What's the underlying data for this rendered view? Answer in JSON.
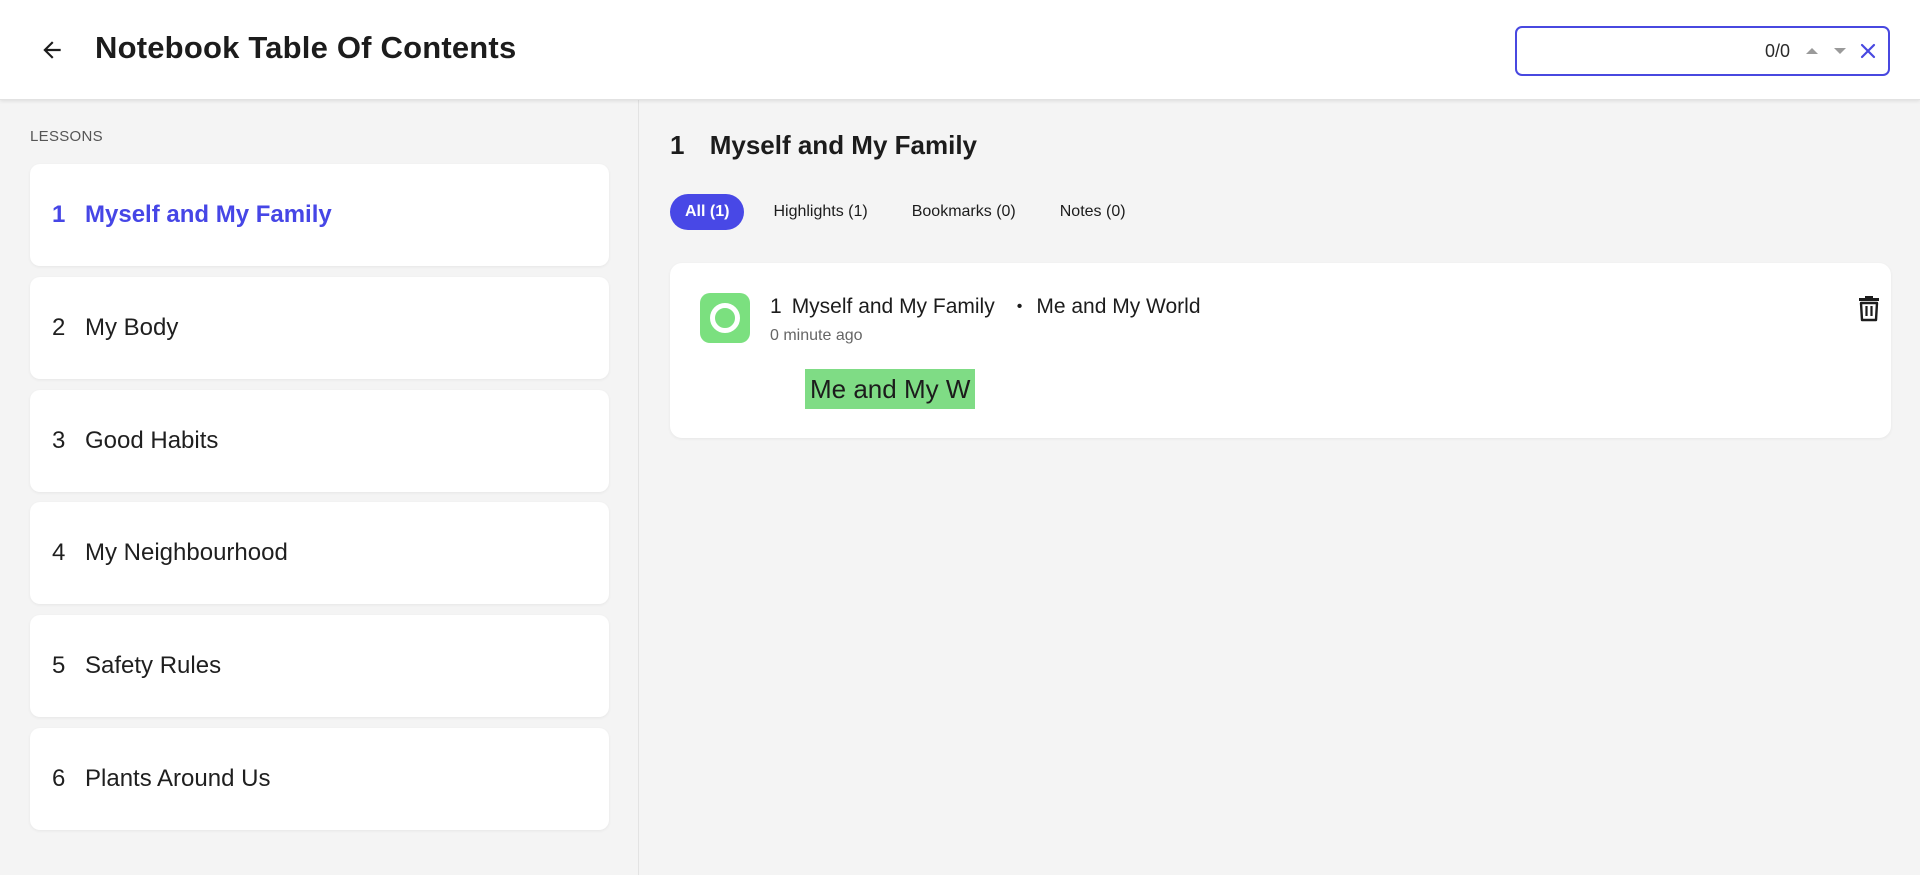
{
  "header": {
    "title": "Notebook Table Of Contents",
    "search": {
      "value": "",
      "placeholder": "",
      "count": "0/0"
    }
  },
  "sidebar": {
    "section_label": "LESSONS",
    "items": [
      {
        "num": "1",
        "label": "Myself and My Family",
        "active": true
      },
      {
        "num": "2",
        "label": "My Body"
      },
      {
        "num": "3",
        "label": "Good Habits"
      },
      {
        "num": "4",
        "label": "My Neighbourhood"
      },
      {
        "num": "5",
        "label": "Safety Rules"
      },
      {
        "num": "6",
        "label": "Plants Around Us"
      }
    ]
  },
  "main": {
    "chapter": {
      "num": "1",
      "title": "Myself and My Family"
    },
    "filters": [
      {
        "label": "All (1)",
        "active": true
      },
      {
        "label": "Highlights (1)"
      },
      {
        "label": "Bookmarks (0)"
      },
      {
        "label": "Notes (0)"
      }
    ],
    "notes": [
      {
        "chapter_num": "1",
        "chapter_title": "Myself and My Family",
        "dot": "•",
        "section": "Me and My World",
        "time": "0 minute ago",
        "highlight": "Me and My W",
        "highlight_color": "#7fdc85"
      }
    ]
  },
  "colors": {
    "accent": "#4848e6",
    "highlight": "#7fdc85"
  }
}
